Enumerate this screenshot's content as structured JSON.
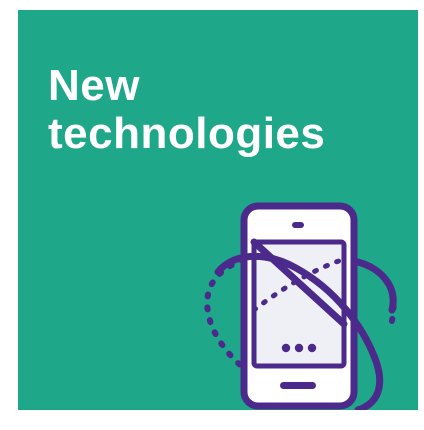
{
  "headline": {
    "line1": "New",
    "line2": "technologies"
  },
  "colors": {
    "tile_background": "#1fa78a",
    "text": "#ffffff",
    "outline": "#4b2a8c",
    "phone_fill": "#ffffff",
    "screen_fill": "#eef0f6"
  },
  "icons": [
    "smartphone-icon",
    "orbit-ring-icon"
  ]
}
